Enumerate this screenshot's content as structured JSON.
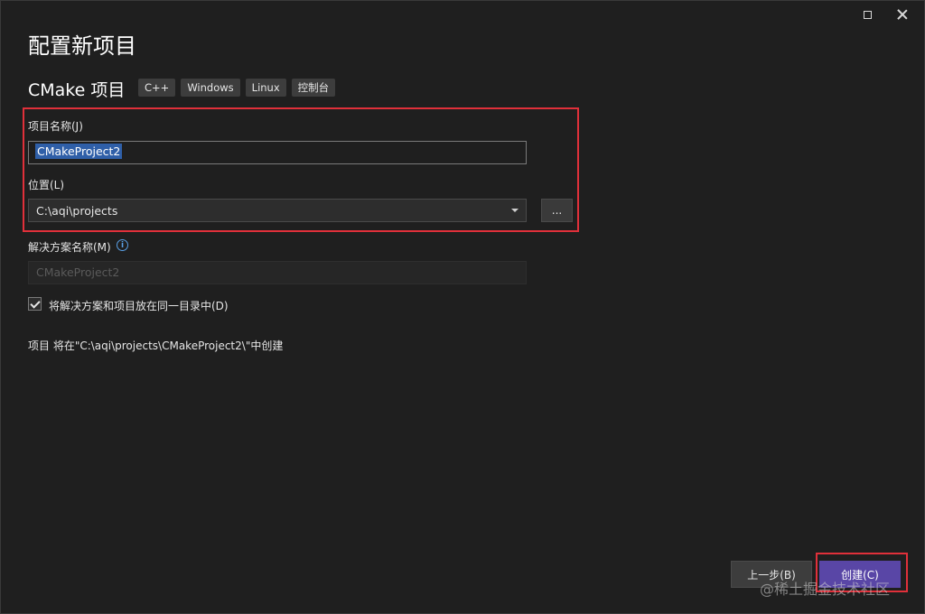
{
  "page": {
    "title": "配置新项目",
    "template_name": "CMake 项目",
    "tags": [
      "C++",
      "Windows",
      "Linux",
      "控制台"
    ]
  },
  "project_name": {
    "label": "项目名称(J)",
    "value": "CMakeProject2"
  },
  "location": {
    "label": "位置(L)",
    "value": "C:\\aqi\\projects",
    "browse_label": "..."
  },
  "solution_name": {
    "label": "解决方案名称(M)",
    "value": "CMakeProject2"
  },
  "same_dir_checkbox": {
    "label": "将解决方案和项目放在同一目录中(D)",
    "checked": true
  },
  "path_summary": "项目 将在\"C:\\aqi\\projects\\CMakeProject2\\\"中创建",
  "buttons": {
    "back": "上一步(B)",
    "create": "创建(C)"
  },
  "watermark": "@稀土掘金技术社区",
  "colors": {
    "highlight_box": "#e0303a",
    "primary_button": "#5946a6",
    "selection": "#2f5fa8"
  }
}
